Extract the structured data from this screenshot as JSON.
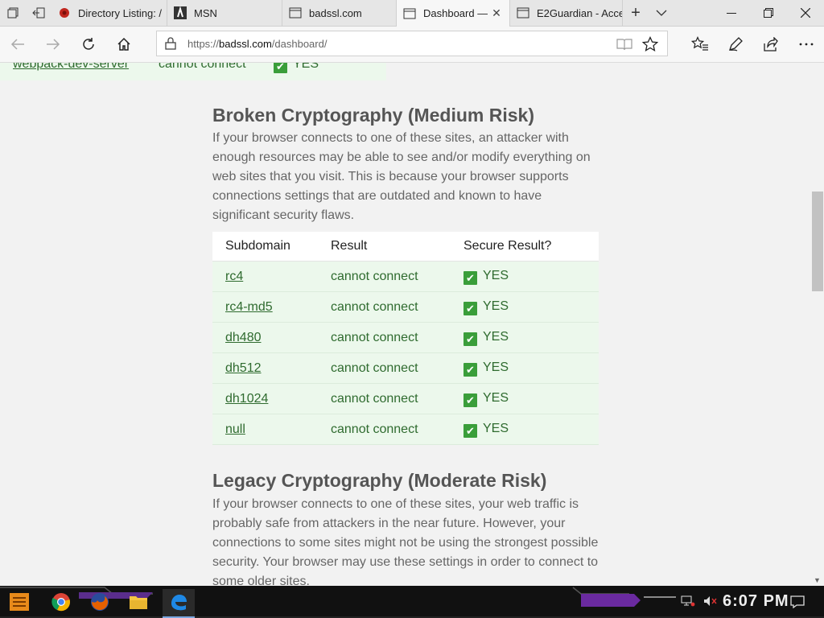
{
  "tabs": [
    {
      "label": "Directory Listing: /",
      "icon": "red-bug-icon"
    },
    {
      "label": "MSN",
      "icon": "msn-icon"
    },
    {
      "label": "badssl.com",
      "icon": "page-icon"
    },
    {
      "label": "Dashboard — ",
      "icon": "page-icon",
      "active": true
    },
    {
      "label": "E2Guardian - Acce",
      "icon": "page-icon"
    }
  ],
  "address": {
    "scheme": "https://",
    "host": "badssl.com",
    "path": "/dashboard/"
  },
  "page": {
    "prev_row": {
      "subdomain": "webpack-dev-server",
      "result": "cannot connect",
      "secure": "YES"
    },
    "broken": {
      "heading": "Broken Cryptography (Medium Risk)",
      "description": "If your browser connects to one of these sites, an attacker with enough resources may be able to see and/or modify everything on web sites that you visit. This is because your browser supports connections settings that are outdated and known to have significant security flaws.",
      "columns": [
        "Subdomain",
        "Result",
        "Secure Result?"
      ],
      "rows": [
        {
          "subdomain": "rc4",
          "result": "cannot connect",
          "secure": "YES"
        },
        {
          "subdomain": "rc4-md5",
          "result": "cannot connect",
          "secure": "YES"
        },
        {
          "subdomain": "dh480",
          "result": "cannot connect",
          "secure": "YES"
        },
        {
          "subdomain": "dh512",
          "result": "cannot connect",
          "secure": "YES"
        },
        {
          "subdomain": "dh1024",
          "result": "cannot connect",
          "secure": "YES"
        },
        {
          "subdomain": "null",
          "result": "cannot connect",
          "secure": "YES"
        }
      ]
    },
    "legacy": {
      "heading": "Legacy Cryptography (Moderate Risk)",
      "description": "If your browser connects to one of these sites, your web traffic is probably safe from attackers in the near future. However, your connections to some sites might not be using the strongest possible security. Your browser may use these settings in order to connect to some older sites."
    }
  },
  "taskbar": {
    "clock": "6:07 PM"
  },
  "colors": {
    "row_bg": "#ecf8ec",
    "check_green": "#3a9e3a",
    "accent_link": "#2f6b2f"
  }
}
